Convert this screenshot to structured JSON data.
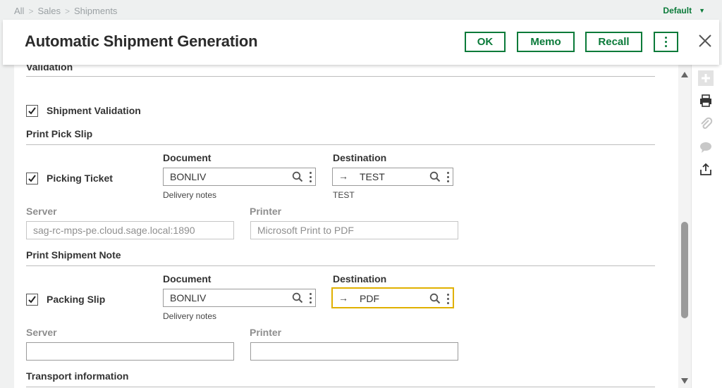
{
  "breadcrumb": {
    "items": [
      "All",
      "Sales",
      "Shipments"
    ]
  },
  "profile": {
    "label": "Default"
  },
  "header": {
    "title": "Automatic Shipment Generation",
    "ok_label": "OK",
    "memo_label": "Memo",
    "recall_label": "Recall"
  },
  "sections": {
    "validation": {
      "title": "Validation",
      "checkbox_label": "Shipment Validation",
      "checked": true
    },
    "pick_slip": {
      "title": "Print Pick Slip",
      "checkbox_label": "Picking Ticket",
      "checked": true,
      "document_label": "Document",
      "document_value": "BONLIV",
      "document_hint": "Delivery notes",
      "destination_label": "Destination",
      "destination_value": "TEST",
      "destination_hint": "TEST",
      "server_label": "Server",
      "server_value": "sag-rc-mps-pe.cloud.sage.local:1890",
      "printer_label": "Printer",
      "printer_value": "Microsoft Print to PDF"
    },
    "shipment_note": {
      "title": "Print Shipment Note",
      "checkbox_label": "Packing Slip",
      "checked": true,
      "document_label": "Document",
      "document_value": "BONLIV",
      "document_hint": "Delivery notes",
      "destination_label": "Destination",
      "destination_value": "PDF",
      "server_label": "Server",
      "server_value": "",
      "printer_label": "Printer",
      "printer_value": ""
    },
    "transport": {
      "title": "Transport information"
    }
  },
  "colors": {
    "accent": "#0a7a39",
    "focus": "#e0b000"
  },
  "icons": {
    "search": "search-icon",
    "more": "more-vertical-icon",
    "close": "close-icon",
    "arrow": "arrow-right-icon",
    "check": "check-icon"
  },
  "side_tools": [
    "add-icon",
    "print-icon",
    "attachment-icon",
    "comment-icon",
    "export-icon"
  ]
}
